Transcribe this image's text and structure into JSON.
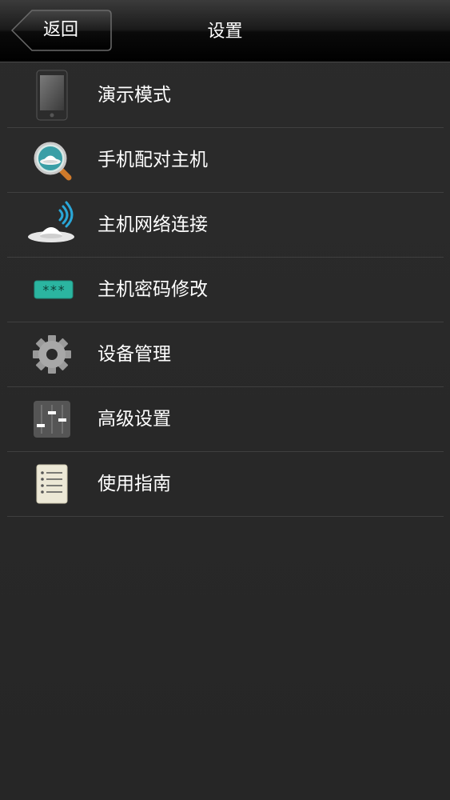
{
  "header": {
    "back_label": "返回",
    "title": "设置"
  },
  "menu": {
    "items": [
      {
        "label": "演示模式",
        "icon": "phone-icon"
      },
      {
        "label": "手机配对主机",
        "icon": "magnifier-icon"
      },
      {
        "label": "主机网络连接",
        "icon": "wifi-hub-icon"
      },
      {
        "label": "主机密码修改",
        "icon": "password-icon"
      },
      {
        "label": "设备管理",
        "icon": "gear-icon"
      },
      {
        "label": "高级设置",
        "icon": "sliders-icon"
      },
      {
        "label": "使用指南",
        "icon": "guide-icon"
      }
    ]
  },
  "colors": {
    "background": "#2a2a2a",
    "divider": "#3f3f3f",
    "text": "#ffffff",
    "accent_teal": "#2bb5a0",
    "accent_blue": "#2aa7d8"
  }
}
